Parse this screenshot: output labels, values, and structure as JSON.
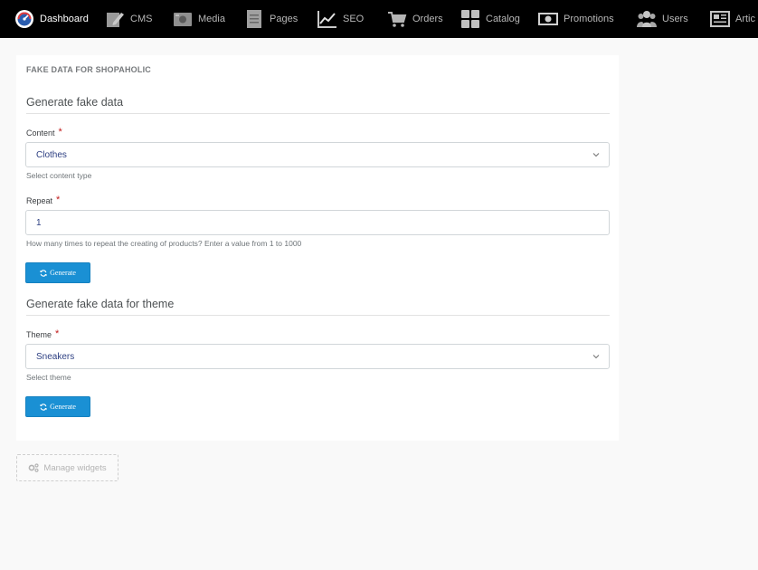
{
  "nav": {
    "items": [
      {
        "label": "Dashboard",
        "icon": "dashboard-gauge-icon"
      },
      {
        "label": "CMS",
        "icon": "cms-pencil-icon"
      },
      {
        "label": "Media",
        "icon": "media-image-icon"
      },
      {
        "label": "Pages",
        "icon": "pages-document-icon"
      },
      {
        "label": "SEO",
        "icon": "seo-chart-icon"
      },
      {
        "label": "Orders",
        "icon": "orders-cart-icon"
      },
      {
        "label": "Catalog",
        "icon": "catalog-grid-icon"
      },
      {
        "label": "Promotions",
        "icon": "promotions-money-icon"
      },
      {
        "label": "Users",
        "icon": "users-group-icon"
      },
      {
        "label": "Artic",
        "icon": "articles-newspaper-icon"
      }
    ]
  },
  "widget": {
    "title": "FAKE DATA FOR SHOPAHOLIC",
    "section1": {
      "title": "Generate fake data",
      "content_label": "Content",
      "content_value": "Clothes",
      "content_help": "Select content type",
      "repeat_label": "Repeat",
      "repeat_value": "1",
      "repeat_help": "How many times to repeat the creating of products? Enter a value from 1 to 1000",
      "button_label": "Generate"
    },
    "section2": {
      "title": "Generate fake data for theme",
      "theme_label": "Theme",
      "theme_value": "Sneakers",
      "theme_help": "Select theme",
      "button_label": "Generate"
    },
    "required_mark": "*"
  },
  "manage_widgets_label": "Manage widgets",
  "colors": {
    "nav_bg": "#000000",
    "primary_button": "#1a90d4",
    "required": "#c11c1c"
  }
}
